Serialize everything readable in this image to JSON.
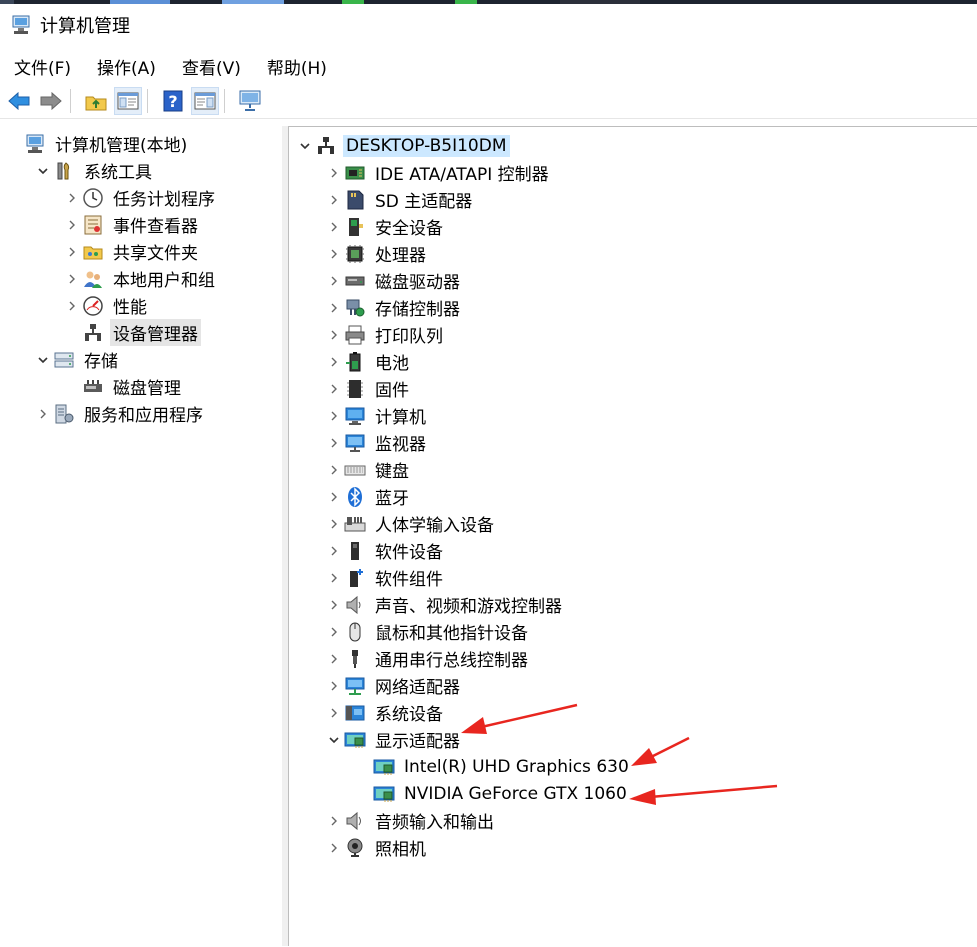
{
  "window": {
    "title": "计算机管理"
  },
  "menu": [
    "文件(F)",
    "操作(A)",
    "查看(V)",
    "帮助(H)"
  ],
  "toolbar": [
    "back-icon",
    "forward-icon",
    "up-folder-icon",
    "show-hide-tree-icon",
    "help-icon",
    "action-pane-icon",
    "monitor-icon"
  ],
  "left_tree": [
    {
      "label": "计算机管理(本地)",
      "icon": "computer-management-icon",
      "level": 0,
      "toggle": "none"
    },
    {
      "label": "系统工具",
      "icon": "system-tools-icon",
      "level": 1,
      "toggle": "expanded"
    },
    {
      "label": "任务计划程序",
      "icon": "clock-icon",
      "level": 2,
      "toggle": "collapsed"
    },
    {
      "label": "事件查看器",
      "icon": "event-viewer-icon",
      "level": 2,
      "toggle": "collapsed"
    },
    {
      "label": "共享文件夹",
      "icon": "shared-folder-icon",
      "level": 2,
      "toggle": "collapsed"
    },
    {
      "label": "本地用户和组",
      "icon": "users-icon",
      "level": 2,
      "toggle": "collapsed"
    },
    {
      "label": "性能",
      "icon": "performance-icon",
      "level": 2,
      "toggle": "collapsed"
    },
    {
      "label": "设备管理器",
      "icon": "device-manager-icon",
      "level": 2,
      "toggle": "none",
      "selected": true
    },
    {
      "label": "存储",
      "icon": "storage-icon",
      "level": 1,
      "toggle": "expanded"
    },
    {
      "label": "磁盘管理",
      "icon": "disk-management-icon",
      "level": 2,
      "toggle": "none"
    },
    {
      "label": "服务和应用程序",
      "icon": "services-icon",
      "level": 1,
      "toggle": "collapsed"
    }
  ],
  "device_tree": [
    {
      "label": "DESKTOP-B5I10DM",
      "icon": "computer-root-icon",
      "level": 0,
      "toggle": "expanded",
      "selected": true
    },
    {
      "label": "IDE ATA/ATAPI 控制器",
      "icon": "ide-controller-icon",
      "level": 1,
      "toggle": "collapsed"
    },
    {
      "label": "SD 主适配器",
      "icon": "sd-adapter-icon",
      "level": 1,
      "toggle": "collapsed"
    },
    {
      "label": "安全设备",
      "icon": "security-device-icon",
      "level": 1,
      "toggle": "collapsed"
    },
    {
      "label": "处理器",
      "icon": "processor-icon",
      "level": 1,
      "toggle": "collapsed"
    },
    {
      "label": "磁盘驱动器",
      "icon": "disk-drive-icon",
      "level": 1,
      "toggle": "collapsed"
    },
    {
      "label": "存储控制器",
      "icon": "storage-controller-icon",
      "level": 1,
      "toggle": "collapsed"
    },
    {
      "label": "打印队列",
      "icon": "printer-icon",
      "level": 1,
      "toggle": "collapsed"
    },
    {
      "label": "电池",
      "icon": "battery-icon",
      "level": 1,
      "toggle": "collapsed"
    },
    {
      "label": "固件",
      "icon": "firmware-icon",
      "level": 1,
      "toggle": "collapsed"
    },
    {
      "label": "计算机",
      "icon": "computer-icon",
      "level": 1,
      "toggle": "collapsed"
    },
    {
      "label": "监视器",
      "icon": "monitor-icon",
      "level": 1,
      "toggle": "collapsed"
    },
    {
      "label": "键盘",
      "icon": "keyboard-icon",
      "level": 1,
      "toggle": "collapsed"
    },
    {
      "label": "蓝牙",
      "icon": "bluetooth-icon",
      "level": 1,
      "toggle": "collapsed"
    },
    {
      "label": "人体学输入设备",
      "icon": "hid-icon",
      "level": 1,
      "toggle": "collapsed"
    },
    {
      "label": "软件设备",
      "icon": "software-device-icon",
      "level": 1,
      "toggle": "collapsed"
    },
    {
      "label": "软件组件",
      "icon": "software-component-icon",
      "level": 1,
      "toggle": "collapsed"
    },
    {
      "label": "声音、视频和游戏控制器",
      "icon": "speaker-icon",
      "level": 1,
      "toggle": "collapsed"
    },
    {
      "label": "鼠标和其他指针设备",
      "icon": "mouse-icon",
      "level": 1,
      "toggle": "collapsed"
    },
    {
      "label": "通用串行总线控制器",
      "icon": "usb-icon",
      "level": 1,
      "toggle": "collapsed"
    },
    {
      "label": "网络适配器",
      "icon": "network-adapter-icon",
      "level": 1,
      "toggle": "collapsed"
    },
    {
      "label": "系统设备",
      "icon": "system-device-icon",
      "level": 1,
      "toggle": "collapsed"
    },
    {
      "label": "显示适配器",
      "icon": "display-adapter-icon",
      "level": 1,
      "toggle": "expanded"
    },
    {
      "label": "Intel(R) UHD Graphics 630",
      "icon": "display-adapter-icon",
      "level": 2,
      "toggle": "none"
    },
    {
      "label": "NVIDIA GeForce GTX 1060",
      "icon": "display-adapter-icon",
      "level": 2,
      "toggle": "none"
    },
    {
      "label": "音频输入和输出",
      "icon": "audio-io-icon",
      "level": 1,
      "toggle": "collapsed"
    },
    {
      "label": "照相机",
      "icon": "camera-icon",
      "level": 1,
      "toggle": "collapsed"
    }
  ],
  "colors": {
    "selection": "#cce8ff",
    "selection_gray": "#e5e5e5",
    "annotation_arrow": "#e8261f"
  }
}
